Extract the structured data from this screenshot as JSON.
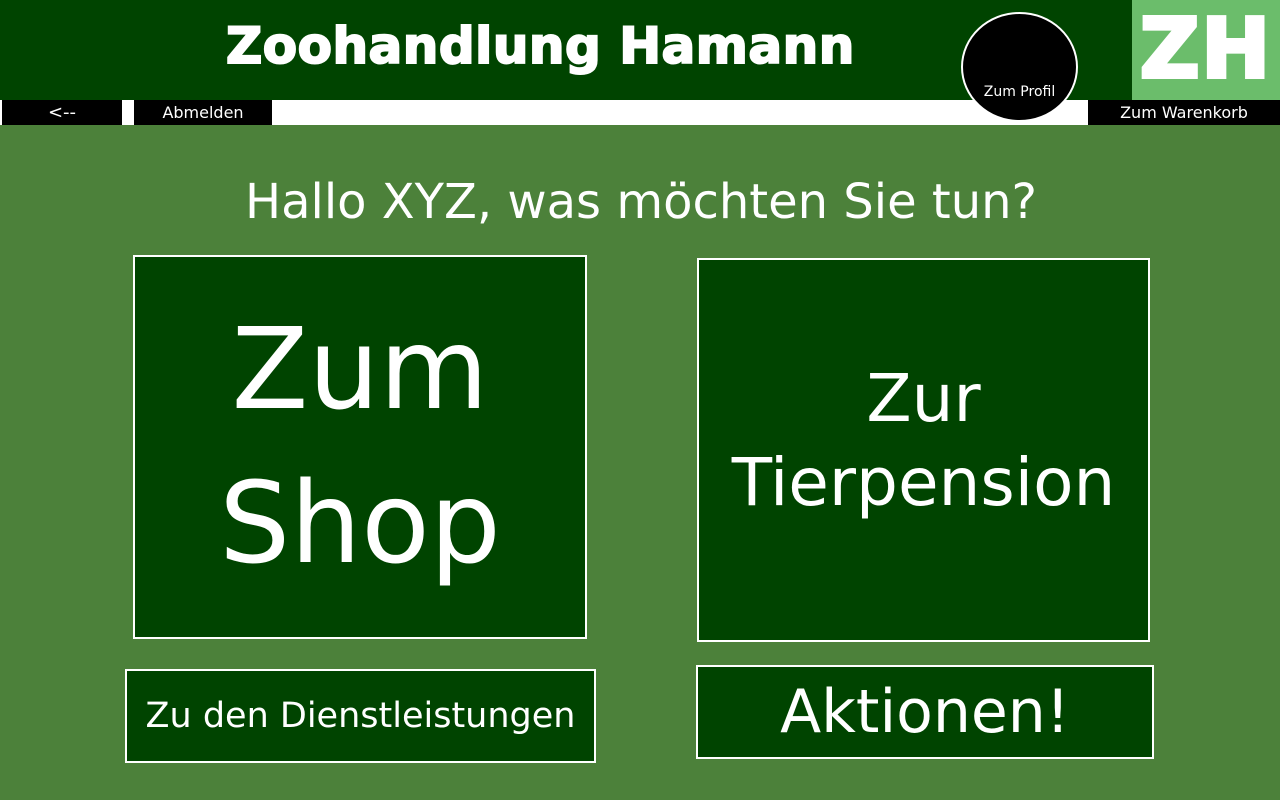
{
  "header": {
    "title": "Zoohandlung Hamann",
    "logo_text": "ZH",
    "profile_label": "Zum Profil"
  },
  "nav": {
    "back_label": "<--",
    "logout_label": "Abmelden",
    "cart_label": "Zum Warenkorb"
  },
  "main": {
    "greeting": "Hallo XYZ, was möchten Sie tun?",
    "shop_line1": "Zum",
    "shop_line2": "Shop",
    "pension_line1": "Zur",
    "pension_line2": "Tierpension",
    "services_label": "Zu den Dienstleistungen",
    "actions_label": "Aktionen!"
  },
  "colors": {
    "background": "#4c813a",
    "dark_green": "#004400",
    "logo_green": "#6bbd6b",
    "nav_black": "#000000",
    "text_white": "#ffffff"
  }
}
